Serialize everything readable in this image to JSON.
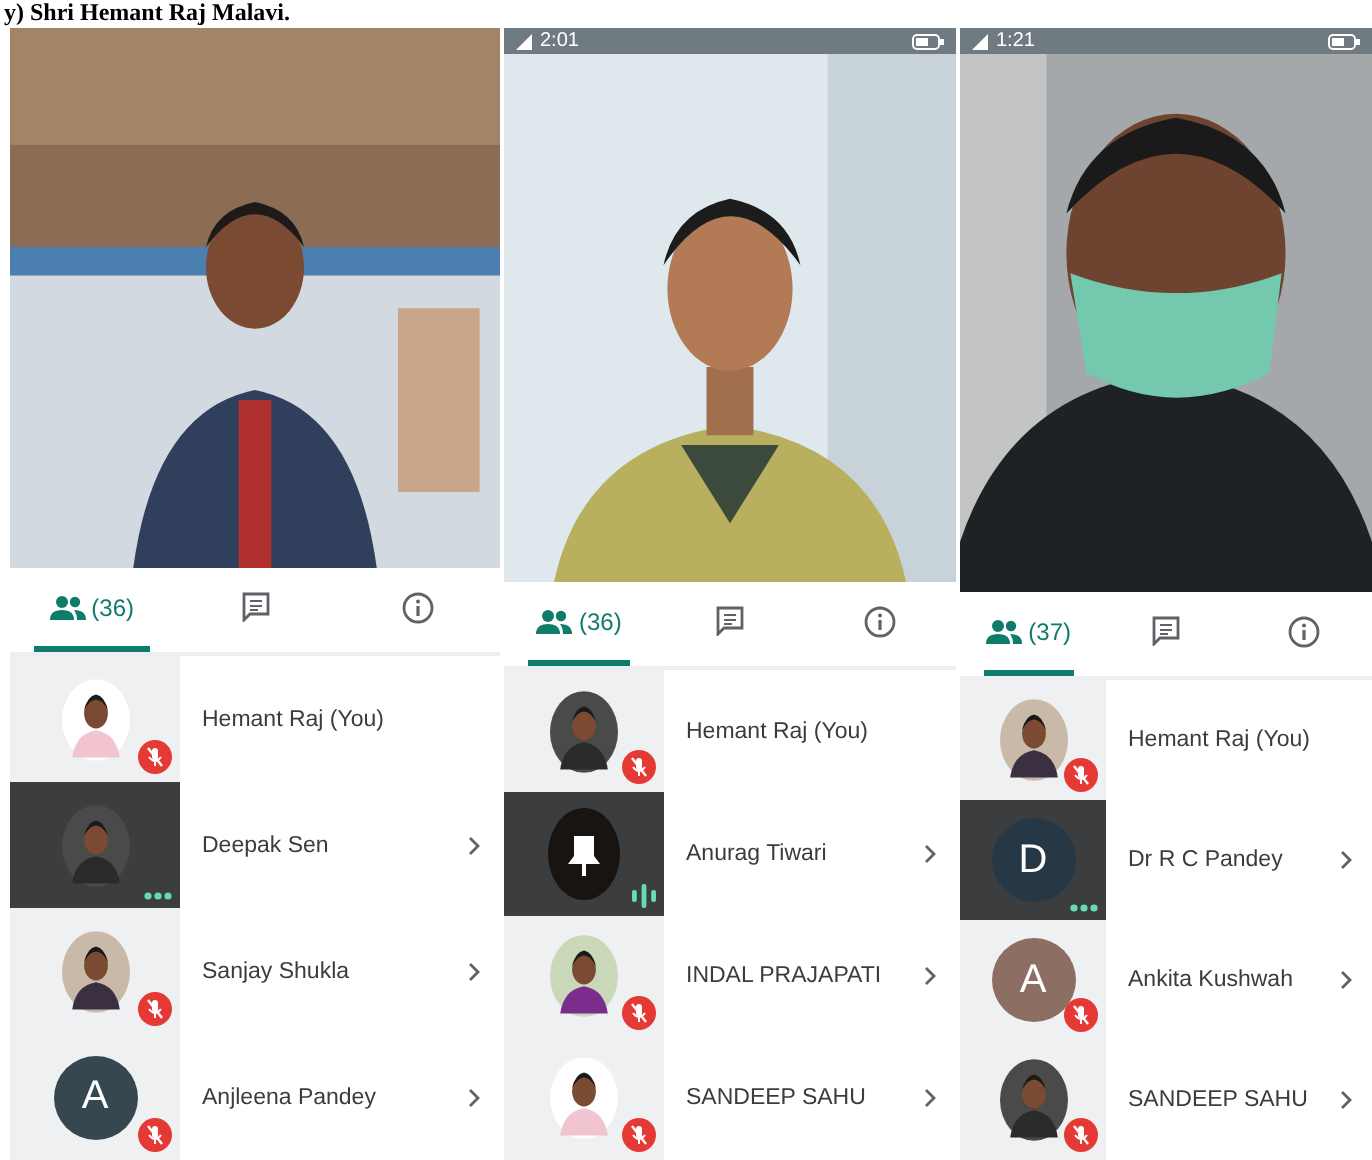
{
  "caption": "y) Shri Hemant Raj Malavi.",
  "panels": [
    {
      "tabs": [
        {
          "kind": "people",
          "label": "(36)",
          "selected": true
        },
        {
          "kind": "chat",
          "selected": false
        },
        {
          "kind": "info",
          "selected": false
        }
      ],
      "participants": [
        {
          "name": "Hemant Raj (You)",
          "indicator": {
            "kind": "muted"
          },
          "selected": false,
          "has_details": false
        },
        {
          "name": "Deepak Sen",
          "indicator": {
            "kind": "dots"
          },
          "selected": true,
          "has_details": true
        },
        {
          "name": "Sanjay Shukla",
          "indicator": {
            "kind": "muted"
          },
          "selected": false,
          "has_details": true
        },
        {
          "name": "Anjleena Pandey",
          "avatar": {
            "kind": "letter",
            "letter": "A",
            "color": "#37474f"
          },
          "indicator": {
            "kind": "muted"
          },
          "selected": false,
          "has_details": true
        }
      ]
    },
    {
      "status_bar": {
        "time": "2:01"
      },
      "tabs": [
        {
          "kind": "people",
          "label": "(36)",
          "selected": true
        },
        {
          "kind": "chat",
          "selected": false
        },
        {
          "kind": "info",
          "selected": false
        }
      ],
      "participants": [
        {
          "name": "Hemant Raj (You)",
          "indicator": {
            "kind": "muted"
          },
          "selected": false,
          "has_details": false
        },
        {
          "name": "Anurag Tiwari",
          "avatar": {
            "kind": "bell"
          },
          "indicator": {
            "kind": "bars"
          },
          "selected": true,
          "has_details": true
        },
        {
          "name": "INDAL PRAJAPATI",
          "indicator": {
            "kind": "muted"
          },
          "selected": false,
          "has_details": true
        },
        {
          "name": "SANDEEP SAHU",
          "indicator": {
            "kind": "muted"
          },
          "selected": false,
          "has_details": true
        }
      ]
    },
    {
      "status_bar": {
        "time": "1:21"
      },
      "tabs": [
        {
          "kind": "people",
          "label": "(37)",
          "selected": true
        },
        {
          "kind": "chat",
          "selected": false
        },
        {
          "kind": "info",
          "selected": false
        }
      ],
      "participants": [
        {
          "name": "Hemant Raj (You)",
          "indicator": {
            "kind": "muted"
          },
          "selected": false,
          "has_details": false
        },
        {
          "name": "Dr R C Pandey",
          "avatar": {
            "kind": "letter",
            "letter": "D",
            "color": "#263845"
          },
          "indicator": {
            "kind": "dots"
          },
          "selected": true,
          "has_details": true
        },
        {
          "name": "Ankita Kushwah",
          "avatar": {
            "kind": "letter",
            "letter": "A",
            "color": "#8d6e63"
          },
          "indicator": {
            "kind": "muted"
          },
          "selected": false,
          "has_details": true
        },
        {
          "name": "SANDEEP SAHU",
          "indicator": {
            "kind": "muted"
          },
          "selected": false,
          "has_details": true
        }
      ]
    }
  ]
}
